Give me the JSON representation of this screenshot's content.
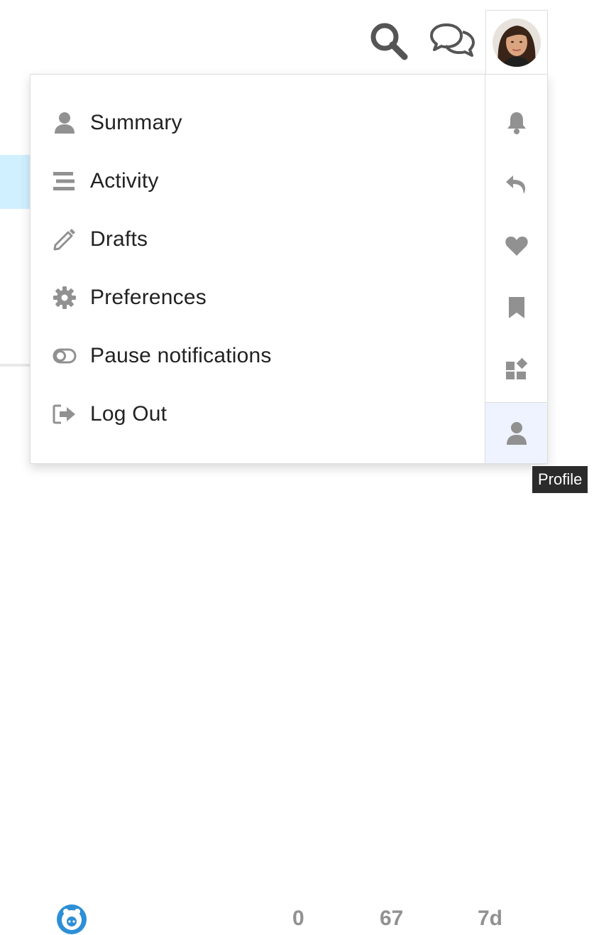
{
  "header": {
    "search_icon": "search-icon",
    "chat_icon": "chat-icon",
    "avatar": "user-avatar"
  },
  "user_menu": {
    "items": [
      {
        "label": "Summary",
        "icon": "user-icon"
      },
      {
        "label": "Activity",
        "icon": "activity-lines-icon"
      },
      {
        "label": "Drafts",
        "icon": "pencil-icon"
      },
      {
        "label": "Preferences",
        "icon": "gear-icon"
      },
      {
        "label": "Pause notifications",
        "icon": "toggle-off-icon"
      },
      {
        "label": "Log Out",
        "icon": "sign-out-icon"
      }
    ],
    "side_tabs": [
      {
        "icon": "bell-icon",
        "active": false
      },
      {
        "icon": "reply-icon",
        "active": false
      },
      {
        "icon": "heart-icon",
        "active": false
      },
      {
        "icon": "bookmark-icon",
        "active": false
      },
      {
        "icon": "shapes-icon",
        "active": false
      },
      {
        "icon": "user-icon",
        "active": true
      }
    ]
  },
  "tooltip": {
    "text": "Profile"
  },
  "background_row": {
    "stats": [
      "0",
      "67",
      "7d"
    ]
  },
  "colors": {
    "icon_gray": "#919191",
    "text": "#222222",
    "active_tab_bg": "#eef3ff",
    "highlight_bg": "#d1f0ff",
    "tooltip_bg": "#2b2b2b"
  }
}
